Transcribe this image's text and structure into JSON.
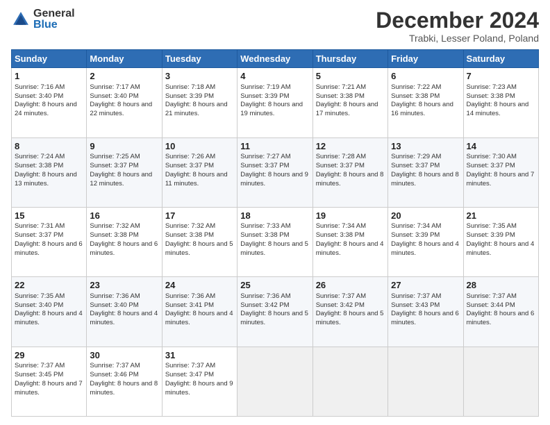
{
  "logo": {
    "general": "General",
    "blue": "Blue"
  },
  "header": {
    "title": "December 2024",
    "subtitle": "Trabki, Lesser Poland, Poland"
  },
  "days_of_week": [
    "Sunday",
    "Monday",
    "Tuesday",
    "Wednesday",
    "Thursday",
    "Friday",
    "Saturday"
  ],
  "weeks": [
    [
      {
        "day": 1,
        "sunrise": "7:16 AM",
        "sunset": "3:40 PM",
        "daylight": "8 hours and 24 minutes."
      },
      {
        "day": 2,
        "sunrise": "7:17 AM",
        "sunset": "3:40 PM",
        "daylight": "8 hours and 22 minutes."
      },
      {
        "day": 3,
        "sunrise": "7:18 AM",
        "sunset": "3:39 PM",
        "daylight": "8 hours and 21 minutes."
      },
      {
        "day": 4,
        "sunrise": "7:19 AM",
        "sunset": "3:39 PM",
        "daylight": "8 hours and 19 minutes."
      },
      {
        "day": 5,
        "sunrise": "7:21 AM",
        "sunset": "3:38 PM",
        "daylight": "8 hours and 17 minutes."
      },
      {
        "day": 6,
        "sunrise": "7:22 AM",
        "sunset": "3:38 PM",
        "daylight": "8 hours and 16 minutes."
      },
      {
        "day": 7,
        "sunrise": "7:23 AM",
        "sunset": "3:38 PM",
        "daylight": "8 hours and 14 minutes."
      }
    ],
    [
      {
        "day": 8,
        "sunrise": "7:24 AM",
        "sunset": "3:38 PM",
        "daylight": "8 hours and 13 minutes."
      },
      {
        "day": 9,
        "sunrise": "7:25 AM",
        "sunset": "3:37 PM",
        "daylight": "8 hours and 12 minutes."
      },
      {
        "day": 10,
        "sunrise": "7:26 AM",
        "sunset": "3:37 PM",
        "daylight": "8 hours and 11 minutes."
      },
      {
        "day": 11,
        "sunrise": "7:27 AM",
        "sunset": "3:37 PM",
        "daylight": "8 hours and 9 minutes."
      },
      {
        "day": 12,
        "sunrise": "7:28 AM",
        "sunset": "3:37 PM",
        "daylight": "8 hours and 8 minutes."
      },
      {
        "day": 13,
        "sunrise": "7:29 AM",
        "sunset": "3:37 PM",
        "daylight": "8 hours and 8 minutes."
      },
      {
        "day": 14,
        "sunrise": "7:30 AM",
        "sunset": "3:37 PM",
        "daylight": "8 hours and 7 minutes."
      }
    ],
    [
      {
        "day": 15,
        "sunrise": "7:31 AM",
        "sunset": "3:37 PM",
        "daylight": "8 hours and 6 minutes."
      },
      {
        "day": 16,
        "sunrise": "7:32 AM",
        "sunset": "3:38 PM",
        "daylight": "8 hours and 6 minutes."
      },
      {
        "day": 17,
        "sunrise": "7:32 AM",
        "sunset": "3:38 PM",
        "daylight": "8 hours and 5 minutes."
      },
      {
        "day": 18,
        "sunrise": "7:33 AM",
        "sunset": "3:38 PM",
        "daylight": "8 hours and 5 minutes."
      },
      {
        "day": 19,
        "sunrise": "7:34 AM",
        "sunset": "3:38 PM",
        "daylight": "8 hours and 4 minutes."
      },
      {
        "day": 20,
        "sunrise": "7:34 AM",
        "sunset": "3:39 PM",
        "daylight": "8 hours and 4 minutes."
      },
      {
        "day": 21,
        "sunrise": "7:35 AM",
        "sunset": "3:39 PM",
        "daylight": "8 hours and 4 minutes."
      }
    ],
    [
      {
        "day": 22,
        "sunrise": "7:35 AM",
        "sunset": "3:40 PM",
        "daylight": "8 hours and 4 minutes."
      },
      {
        "day": 23,
        "sunrise": "7:36 AM",
        "sunset": "3:40 PM",
        "daylight": "8 hours and 4 minutes."
      },
      {
        "day": 24,
        "sunrise": "7:36 AM",
        "sunset": "3:41 PM",
        "daylight": "8 hours and 4 minutes."
      },
      {
        "day": 25,
        "sunrise": "7:36 AM",
        "sunset": "3:42 PM",
        "daylight": "8 hours and 5 minutes."
      },
      {
        "day": 26,
        "sunrise": "7:37 AM",
        "sunset": "3:42 PM",
        "daylight": "8 hours and 5 minutes."
      },
      {
        "day": 27,
        "sunrise": "7:37 AM",
        "sunset": "3:43 PM",
        "daylight": "8 hours and 6 minutes."
      },
      {
        "day": 28,
        "sunrise": "7:37 AM",
        "sunset": "3:44 PM",
        "daylight": "8 hours and 6 minutes."
      }
    ],
    [
      {
        "day": 29,
        "sunrise": "7:37 AM",
        "sunset": "3:45 PM",
        "daylight": "8 hours and 7 minutes."
      },
      {
        "day": 30,
        "sunrise": "7:37 AM",
        "sunset": "3:46 PM",
        "daylight": "8 hours and 8 minutes."
      },
      {
        "day": 31,
        "sunrise": "7:37 AM",
        "sunset": "3:47 PM",
        "daylight": "8 hours and 9 minutes."
      },
      null,
      null,
      null,
      null
    ]
  ]
}
